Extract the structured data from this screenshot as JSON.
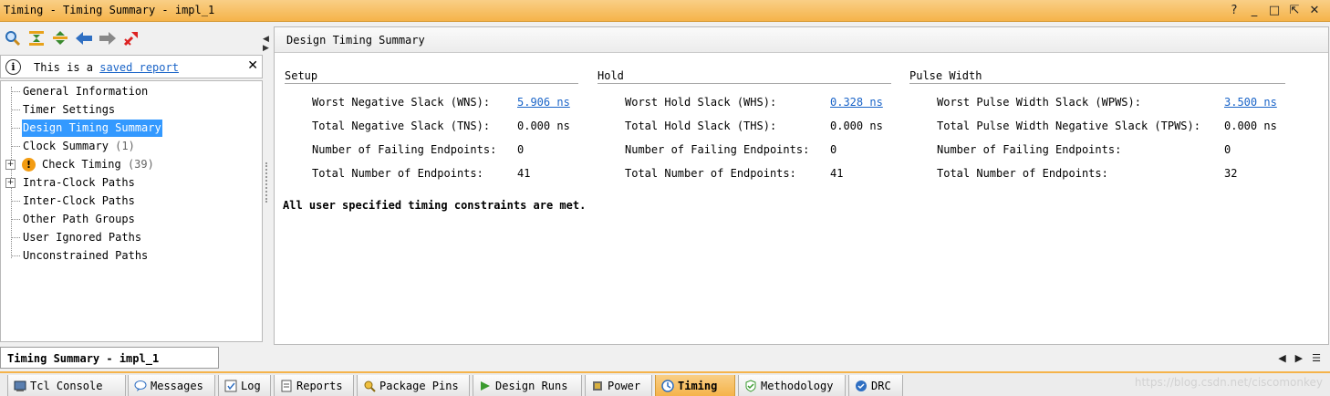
{
  "window": {
    "title": "Timing - Timing Summary - impl_1",
    "buttons": [
      "?",
      "_",
      "□",
      "⇱",
      "✕"
    ]
  },
  "toolbar": {
    "icons": [
      "search-icon",
      "collapse-all-icon",
      "expand-all-icon",
      "back-arrow-icon",
      "forward-arrow-icon",
      "cross-probe-icon"
    ]
  },
  "info_bar": {
    "icon": "i",
    "text_prefix": "This is a ",
    "link": "saved report",
    "close": "✕"
  },
  "tree": {
    "items": [
      {
        "label": "General Information",
        "count": ""
      },
      {
        "label": "Timer Settings",
        "count": ""
      },
      {
        "label": "Design Timing Summary",
        "count": "",
        "selected": true
      },
      {
        "label": "Clock Summary",
        "count": "(1)"
      },
      {
        "label": "Check Timing",
        "count": "(39)",
        "expandable": true,
        "warning": true
      },
      {
        "label": "Intra-Clock Paths",
        "count": "",
        "expandable": true
      },
      {
        "label": "Inter-Clock Paths",
        "count": ""
      },
      {
        "label": "Other Path Groups",
        "count": ""
      },
      {
        "label": "User Ignored Paths",
        "count": ""
      },
      {
        "label": "Unconstrained Paths",
        "count": ""
      }
    ]
  },
  "main": {
    "header": "Design Timing Summary",
    "setup": {
      "title": "Setup",
      "rows": [
        {
          "label": "Worst Negative Slack (WNS):",
          "value": "5.906 ns",
          "link": true
        },
        {
          "label": "Total Negative Slack (TNS):",
          "value": "0.000 ns"
        },
        {
          "label": "Number of Failing Endpoints:",
          "value": "0"
        },
        {
          "label": "Total Number of Endpoints:",
          "value": "41"
        }
      ]
    },
    "hold": {
      "title": "Hold",
      "rows": [
        {
          "label": "Worst Hold Slack (WHS):",
          "value": "0.328 ns",
          "link": true
        },
        {
          "label": "Total Hold Slack (THS):",
          "value": "0.000 ns"
        },
        {
          "label": "Number of Failing Endpoints:",
          "value": "0"
        },
        {
          "label": "Total Number of Endpoints:",
          "value": "41"
        }
      ]
    },
    "pulse": {
      "title": "Pulse Width",
      "rows": [
        {
          "label": "Worst Pulse Width Slack (WPWS):",
          "value": "3.500 ns",
          "link": true
        },
        {
          "label": "Total Pulse Width Negative Slack (TPWS):",
          "value": "0.000 ns"
        },
        {
          "label": "Number of Failing Endpoints:",
          "value": "0"
        },
        {
          "label": "Total Number of Endpoints:",
          "value": "32"
        }
      ]
    },
    "message": "All user specified timing constraints are met."
  },
  "status_tab": "Timing Summary - impl_1",
  "tabs": [
    {
      "label": "Tcl Console",
      "icon": "console-icon"
    },
    {
      "label": "Messages",
      "icon": "messages-icon"
    },
    {
      "label": "Log",
      "icon": "log-icon"
    },
    {
      "label": "Reports",
      "icon": "reports-icon"
    },
    {
      "label": "Package Pins",
      "icon": "package-pins-icon"
    },
    {
      "label": "Design Runs",
      "icon": "design-runs-icon"
    },
    {
      "label": "Power",
      "icon": "power-icon"
    },
    {
      "label": "Timing",
      "icon": "timing-icon",
      "active": true
    },
    {
      "label": "Methodology",
      "icon": "methodology-icon"
    },
    {
      "label": "DRC",
      "icon": "drc-icon"
    }
  ],
  "watermark": "https://blog.csdn.net/ciscomonkey",
  "colors": {
    "accent": "#f5b34a",
    "link": "#1a64c8",
    "selection": "#3399ff",
    "warning": "#f39c12"
  }
}
